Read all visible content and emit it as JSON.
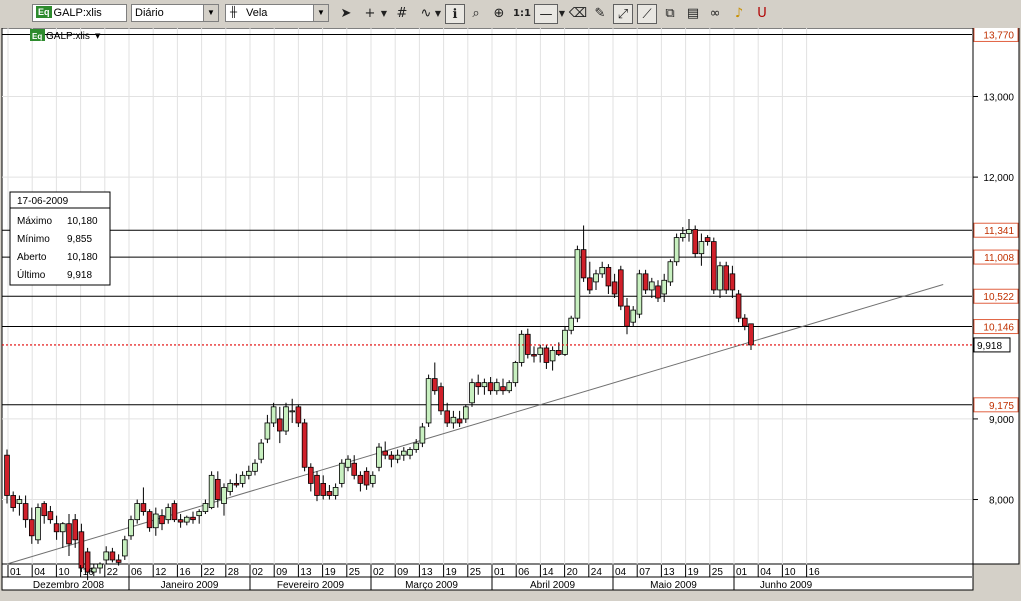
{
  "toolbar": {
    "symbol": "GALP:xlis",
    "symbol_badge": "Eq",
    "period": "Diário",
    "chart_style": "Vela",
    "zoom_1to1": "1:1"
  },
  "chart_header": {
    "symbol": "GALP:xlis",
    "badge": "Eq"
  },
  "info_box": {
    "date": "17-06-2009",
    "rows": [
      {
        "label": "Máximo",
        "value": "10,180"
      },
      {
        "label": "Mínimo",
        "value": "9,855"
      },
      {
        "label": "Aberto",
        "value": "10,180"
      },
      {
        "label": "Último",
        "value": "9,918"
      }
    ]
  },
  "chart_data": {
    "type": "candlestick",
    "ylim": [
      7.2,
      13.85
    ],
    "y_ticks": [
      "13,000",
      "12,000",
      "9,000",
      "8,000"
    ],
    "y_tick_values": [
      13.0,
      12.0,
      9.0,
      8.0
    ],
    "h_levels": [
      {
        "value": 13.77,
        "label": "13,770"
      },
      {
        "value": 11.341,
        "label": "11,341"
      },
      {
        "value": 11.008,
        "label": "11,008"
      },
      {
        "value": 10.522,
        "label": "10,522"
      },
      {
        "value": 10.146,
        "label": "10,146"
      },
      {
        "value": 9.175,
        "label": "9,175"
      }
    ],
    "last_price": {
      "value": 9.918,
      "label": "9,918"
    },
    "trendline": {
      "start": [
        0,
        7.2
      ],
      "end": [
        151,
        10.668
      ]
    },
    "day_ticks": [
      "01",
      "04",
      "10",
      "16",
      "22",
      "06",
      "12",
      "16",
      "22",
      "28",
      "02",
      "09",
      "13",
      "19",
      "25",
      "02",
      "09",
      "13",
      "19",
      "25",
      "01",
      "06",
      "14",
      "20",
      "24",
      "04",
      "07",
      "13",
      "19",
      "25",
      "01",
      "04",
      "10",
      "16"
    ],
    "month_labels": [
      "Dezembro 2008",
      "Janeiro 2009",
      "Fevereiro 2009",
      "Março 2009",
      "Abril 2009",
      "Maio 2009",
      "Junho 2009"
    ],
    "candles": [
      {
        "o": 8.55,
        "h": 8.62,
        "l": 7.95,
        "c": 8.05
      },
      {
        "o": 8.05,
        "h": 8.1,
        "l": 7.85,
        "c": 7.9
      },
      {
        "o": 7.95,
        "h": 8.05,
        "l": 7.8,
        "c": 8.0
      },
      {
        "o": 7.95,
        "h": 8.05,
        "l": 7.65,
        "c": 7.75
      },
      {
        "o": 7.75,
        "h": 7.9,
        "l": 7.45,
        "c": 7.55
      },
      {
        "o": 7.5,
        "h": 7.95,
        "l": 7.45,
        "c": 7.9
      },
      {
        "o": 7.95,
        "h": 7.98,
        "l": 7.7,
        "c": 7.8
      },
      {
        "o": 7.85,
        "h": 7.92,
        "l": 7.7,
        "c": 7.75
      },
      {
        "o": 7.7,
        "h": 7.8,
        "l": 7.5,
        "c": 7.6
      },
      {
        "o": 7.6,
        "h": 7.72,
        "l": 7.4,
        "c": 7.7
      },
      {
        "o": 7.7,
        "h": 7.82,
        "l": 7.3,
        "c": 7.45
      },
      {
        "o": 7.75,
        "h": 7.82,
        "l": 7.4,
        "c": 7.5
      },
      {
        "o": 7.6,
        "h": 7.7,
        "l": 7.1,
        "c": 7.15
      },
      {
        "o": 7.35,
        "h": 7.4,
        "l": 7.0,
        "c": 7.1
      },
      {
        "o": 7.1,
        "h": 7.2,
        "l": 7.05,
        "c": 7.15
      },
      {
        "o": 7.15,
        "h": 7.22,
        "l": 7.08,
        "c": 7.2
      },
      {
        "o": 7.25,
        "h": 7.42,
        "l": 7.2,
        "c": 7.35
      },
      {
        "o": 7.35,
        "h": 7.4,
        "l": 7.22,
        "c": 7.25
      },
      {
        "o": 7.25,
        "h": 7.32,
        "l": 7.18,
        "c": 7.22
      },
      {
        "o": 7.3,
        "h": 7.55,
        "l": 7.25,
        "c": 7.5
      },
      {
        "o": 7.55,
        "h": 7.8,
        "l": 7.5,
        "c": 7.75
      },
      {
        "o": 7.75,
        "h": 8.0,
        "l": 7.7,
        "c": 7.95
      },
      {
        "o": 7.95,
        "h": 8.15,
        "l": 7.8,
        "c": 7.85
      },
      {
        "o": 7.85,
        "h": 7.88,
        "l": 7.6,
        "c": 7.65
      },
      {
        "o": 7.65,
        "h": 7.9,
        "l": 7.55,
        "c": 7.82
      },
      {
        "o": 7.8,
        "h": 7.88,
        "l": 7.62,
        "c": 7.7
      },
      {
        "o": 7.75,
        "h": 7.95,
        "l": 7.7,
        "c": 7.9
      },
      {
        "o": 7.95,
        "h": 7.99,
        "l": 7.72,
        "c": 7.75
      },
      {
        "o": 7.75,
        "h": 7.82,
        "l": 7.65,
        "c": 7.72
      },
      {
        "o": 7.72,
        "h": 7.8,
        "l": 7.68,
        "c": 7.78
      },
      {
        "o": 7.78,
        "h": 7.85,
        "l": 7.7,
        "c": 7.75
      },
      {
        "o": 7.8,
        "h": 7.88,
        "l": 7.7,
        "c": 7.85
      },
      {
        "o": 7.85,
        "h": 8.0,
        "l": 7.82,
        "c": 7.95
      },
      {
        "o": 7.9,
        "h": 8.35,
        "l": 7.88,
        "c": 8.3
      },
      {
        "o": 8.25,
        "h": 8.35,
        "l": 7.9,
        "c": 8.0
      },
      {
        "o": 7.95,
        "h": 8.2,
        "l": 7.8,
        "c": 8.15
      },
      {
        "o": 8.1,
        "h": 8.25,
        "l": 8.05,
        "c": 8.2
      },
      {
        "o": 8.2,
        "h": 8.32,
        "l": 8.15,
        "c": 8.18
      },
      {
        "o": 8.2,
        "h": 8.35,
        "l": 8.15,
        "c": 8.3
      },
      {
        "o": 8.3,
        "h": 8.42,
        "l": 8.25,
        "c": 8.35
      },
      {
        "o": 8.35,
        "h": 8.5,
        "l": 8.3,
        "c": 8.45
      },
      {
        "o": 8.5,
        "h": 8.75,
        "l": 8.45,
        "c": 8.7
      },
      {
        "o": 8.75,
        "h": 9.05,
        "l": 8.7,
        "c": 8.95
      },
      {
        "o": 8.95,
        "h": 9.2,
        "l": 8.9,
        "c": 9.15
      },
      {
        "o": 9.0,
        "h": 9.15,
        "l": 8.7,
        "c": 8.85
      },
      {
        "o": 8.85,
        "h": 9.2,
        "l": 8.8,
        "c": 9.15
      },
      {
        "o": 9.1,
        "h": 9.25,
        "l": 8.95,
        "c": 9.1
      },
      {
        "o": 9.15,
        "h": 9.18,
        "l": 8.9,
        "c": 8.95
      },
      {
        "o": 8.95,
        "h": 9.0,
        "l": 8.35,
        "c": 8.4
      },
      {
        "o": 8.4,
        "h": 8.45,
        "l": 8.1,
        "c": 8.2
      },
      {
        "o": 8.3,
        "h": 8.35,
        "l": 7.98,
        "c": 8.05
      },
      {
        "o": 8.2,
        "h": 8.3,
        "l": 8.0,
        "c": 8.05
      },
      {
        "o": 8.1,
        "h": 8.18,
        "l": 8.0,
        "c": 8.05
      },
      {
        "o": 8.05,
        "h": 8.2,
        "l": 8.0,
        "c": 8.15
      },
      {
        "o": 8.2,
        "h": 8.5,
        "l": 8.15,
        "c": 8.45
      },
      {
        "o": 8.4,
        "h": 8.55,
        "l": 8.35,
        "c": 8.5
      },
      {
        "o": 8.45,
        "h": 8.55,
        "l": 8.25,
        "c": 8.3
      },
      {
        "o": 8.3,
        "h": 8.35,
        "l": 8.1,
        "c": 8.2
      },
      {
        "o": 8.35,
        "h": 8.4,
        "l": 8.12,
        "c": 8.18
      },
      {
        "o": 8.2,
        "h": 8.35,
        "l": 8.15,
        "c": 8.3
      },
      {
        "o": 8.4,
        "h": 8.7,
        "l": 8.35,
        "c": 8.65
      },
      {
        "o": 8.6,
        "h": 8.72,
        "l": 8.5,
        "c": 8.55
      },
      {
        "o": 8.55,
        "h": 8.6,
        "l": 8.4,
        "c": 8.5
      },
      {
        "o": 8.5,
        "h": 8.62,
        "l": 8.45,
        "c": 8.55
      },
      {
        "o": 8.55,
        "h": 8.65,
        "l": 8.48,
        "c": 8.6
      },
      {
        "o": 8.55,
        "h": 8.65,
        "l": 8.5,
        "c": 8.62
      },
      {
        "o": 8.62,
        "h": 8.75,
        "l": 8.58,
        "c": 8.7
      },
      {
        "o": 8.7,
        "h": 8.95,
        "l": 8.65,
        "c": 8.9
      },
      {
        "o": 8.95,
        "h": 9.55,
        "l": 8.9,
        "c": 9.5
      },
      {
        "o": 9.5,
        "h": 9.7,
        "l": 9.3,
        "c": 9.35
      },
      {
        "o": 9.4,
        "h": 9.45,
        "l": 9.05,
        "c": 9.1
      },
      {
        "o": 9.1,
        "h": 9.2,
        "l": 8.9,
        "c": 8.95
      },
      {
        "o": 8.95,
        "h": 9.1,
        "l": 8.88,
        "c": 9.02
      },
      {
        "o": 9.0,
        "h": 9.1,
        "l": 8.9,
        "c": 8.95
      },
      {
        "o": 9.0,
        "h": 9.18,
        "l": 8.95,
        "c": 9.15
      },
      {
        "o": 9.2,
        "h": 9.5,
        "l": 9.15,
        "c": 9.45
      },
      {
        "o": 9.45,
        "h": 9.55,
        "l": 9.3,
        "c": 9.4
      },
      {
        "o": 9.4,
        "h": 9.5,
        "l": 9.3,
        "c": 9.45
      },
      {
        "o": 9.45,
        "h": 9.52,
        "l": 9.3,
        "c": 9.35
      },
      {
        "o": 9.35,
        "h": 9.5,
        "l": 9.3,
        "c": 9.45
      },
      {
        "o": 9.4,
        "h": 9.5,
        "l": 9.3,
        "c": 9.35
      },
      {
        "o": 9.35,
        "h": 9.48,
        "l": 9.32,
        "c": 9.45
      },
      {
        "o": 9.45,
        "h": 9.72,
        "l": 9.4,
        "c": 9.7
      },
      {
        "o": 9.7,
        "h": 10.1,
        "l": 9.65,
        "c": 10.05
      },
      {
        "o": 10.05,
        "h": 10.12,
        "l": 9.75,
        "c": 9.8
      },
      {
        "o": 9.8,
        "h": 9.9,
        "l": 9.7,
        "c": 9.78
      },
      {
        "o": 9.8,
        "h": 9.92,
        "l": 9.7,
        "c": 9.88
      },
      {
        "o": 9.88,
        "h": 9.92,
        "l": 9.62,
        "c": 9.7
      },
      {
        "o": 9.72,
        "h": 9.9,
        "l": 9.6,
        "c": 9.85
      },
      {
        "o": 9.85,
        "h": 9.95,
        "l": 9.78,
        "c": 9.8
      },
      {
        "o": 9.8,
        "h": 10.15,
        "l": 9.78,
        "c": 10.1
      },
      {
        "o": 10.1,
        "h": 10.28,
        "l": 10.05,
        "c": 10.25
      },
      {
        "o": 10.25,
        "h": 11.15,
        "l": 10.2,
        "c": 11.1
      },
      {
        "o": 11.1,
        "h": 11.4,
        "l": 10.7,
        "c": 10.75
      },
      {
        "o": 10.75,
        "h": 10.95,
        "l": 10.55,
        "c": 10.6
      },
      {
        "o": 10.7,
        "h": 10.85,
        "l": 10.6,
        "c": 10.8
      },
      {
        "o": 10.8,
        "h": 10.95,
        "l": 10.75,
        "c": 10.88
      },
      {
        "o": 10.88,
        "h": 10.92,
        "l": 10.55,
        "c": 10.65
      },
      {
        "o": 10.7,
        "h": 10.8,
        "l": 10.5,
        "c": 10.55
      },
      {
        "o": 10.85,
        "h": 10.9,
        "l": 10.35,
        "c": 10.4
      },
      {
        "o": 10.4,
        "h": 10.5,
        "l": 10.05,
        "c": 10.15
      },
      {
        "o": 10.2,
        "h": 10.4,
        "l": 10.15,
        "c": 10.35
      },
      {
        "o": 10.3,
        "h": 10.85,
        "l": 10.25,
        "c": 10.8
      },
      {
        "o": 10.8,
        "h": 10.85,
        "l": 10.55,
        "c": 10.6
      },
      {
        "o": 10.6,
        "h": 10.75,
        "l": 10.5,
        "c": 10.7
      },
      {
        "o": 10.65,
        "h": 10.72,
        "l": 10.45,
        "c": 10.5
      },
      {
        "o": 10.55,
        "h": 10.8,
        "l": 10.45,
        "c": 10.72
      },
      {
        "o": 10.7,
        "h": 10.98,
        "l": 10.65,
        "c": 10.95
      },
      {
        "o": 10.95,
        "h": 11.3,
        "l": 10.9,
        "c": 11.25
      },
      {
        "o": 11.25,
        "h": 11.38,
        "l": 11.2,
        "c": 11.3
      },
      {
        "o": 11.3,
        "h": 11.48,
        "l": 11.2,
        "c": 11.35
      },
      {
        "o": 11.35,
        "h": 11.4,
        "l": 11.0,
        "c": 11.05
      },
      {
        "o": 11.05,
        "h": 11.3,
        "l": 10.9,
        "c": 11.2
      },
      {
        "o": 11.25,
        "h": 11.28,
        "l": 11.15,
        "c": 11.2
      },
      {
        "o": 11.2,
        "h": 11.25,
        "l": 10.55,
        "c": 10.6
      },
      {
        "o": 10.6,
        "h": 10.95,
        "l": 10.5,
        "c": 10.9
      },
      {
        "o": 10.9,
        "h": 10.95,
        "l": 10.55,
        "c": 10.6
      },
      {
        "o": 10.8,
        "h": 10.9,
        "l": 10.5,
        "c": 10.6
      },
      {
        "o": 10.55,
        "h": 10.6,
        "l": 10.2,
        "c": 10.25
      },
      {
        "o": 10.25,
        "h": 10.3,
        "l": 10.1,
        "c": 10.15
      },
      {
        "o": 10.18,
        "h": 10.18,
        "l": 9.855,
        "c": 9.918
      }
    ]
  }
}
